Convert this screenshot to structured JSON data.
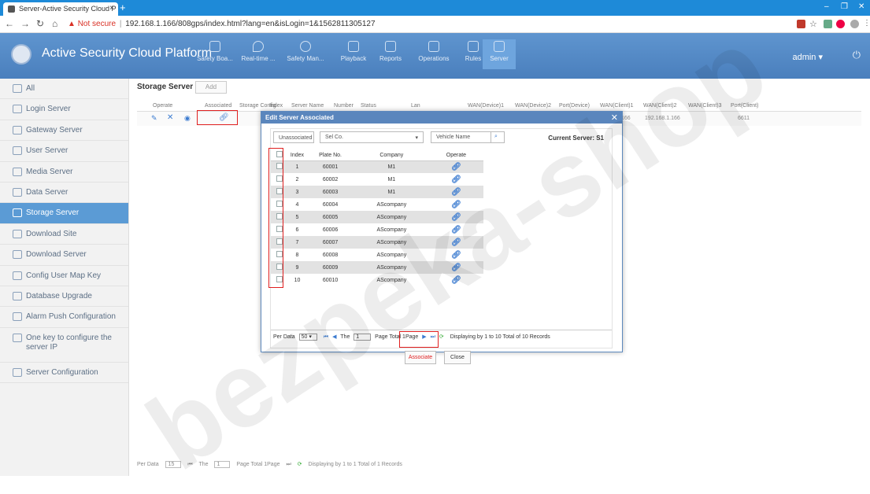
{
  "browser": {
    "tab_title": "Server-Active Security Cloud P",
    "new_tab": "+",
    "not_secure": "Not secure",
    "url": "192.168.1.166/808gps/index.html?lang=en&isLogin=1&1562811305127"
  },
  "app": {
    "title": "Active Security Cloud Platform",
    "nav": [
      "Safety Boa...",
      "Real-time ...",
      "Safety Man...",
      "Playback",
      "Reports",
      "Operations",
      "Rules",
      "Server"
    ],
    "active_nav": "Server",
    "user": "admin ▾"
  },
  "sidebar": {
    "items": [
      {
        "label": "All"
      },
      {
        "label": "Login Server"
      },
      {
        "label": "Gateway Server"
      },
      {
        "label": "User Server"
      },
      {
        "label": "Media Server"
      },
      {
        "label": "Data Server"
      },
      {
        "label": "Storage Server",
        "active": true
      },
      {
        "label": "Download Site"
      },
      {
        "label": "Download Server"
      },
      {
        "label": "Config User Map Key"
      },
      {
        "label": "Database Upgrade"
      },
      {
        "label": "Alarm Push Configuration"
      },
      {
        "label": "One key to configure the server IP"
      },
      {
        "label": "Server Configuration"
      }
    ]
  },
  "main": {
    "title": "Storage Server",
    "add_label": "Add",
    "columns": [
      "Operate",
      "Associated",
      "Storage Config",
      "Index",
      "Server Name",
      "Number",
      "Status",
      "Lan",
      "WAN(Device)1",
      "WAN(Device)2",
      "Port(Device)",
      "WAN(Client)1",
      "WAN(Client)2",
      "WAN(Client)3",
      "Port(Client)"
    ],
    "row": {
      "wan_client_1": "192.168.1.166",
      "port_client": "6611",
      "partial": "166"
    },
    "pager": {
      "per_data": "Per Data",
      "per_value": "15",
      "the": "The",
      "page_value": "1",
      "page_total": "Page  Total 1Page",
      "info": "Displaying by 1 to 1 Total of 1 Records"
    }
  },
  "modal": {
    "title": "Edit Server Associated",
    "filter": {
      "status": "Unassociated",
      "company": "Sel Co.",
      "vehicle_placeholder": "Vehicle Name"
    },
    "current_server": "Current Server: S1",
    "columns": [
      "Index",
      "Plate No.",
      "Company",
      "Operate"
    ],
    "rows": [
      {
        "index": "1",
        "plate": "60001",
        "company": "M1"
      },
      {
        "index": "2",
        "plate": "60002",
        "company": "M1"
      },
      {
        "index": "3",
        "plate": "60003",
        "company": "M1"
      },
      {
        "index": "4",
        "plate": "60004",
        "company": "AScompany"
      },
      {
        "index": "5",
        "plate": "60005",
        "company": "AScompany"
      },
      {
        "index": "6",
        "plate": "60006",
        "company": "AScompany"
      },
      {
        "index": "7",
        "plate": "60007",
        "company": "AScompany"
      },
      {
        "index": "8",
        "plate": "60008",
        "company": "AScompany"
      },
      {
        "index": "9",
        "plate": "60009",
        "company": "AScompany"
      },
      {
        "index": "10",
        "plate": "60010",
        "company": "AScompany"
      }
    ],
    "pager": {
      "per_data": "Per Data",
      "per_value": "50",
      "the": "The",
      "page_value": "1",
      "page_total": "Page  Total 1Page",
      "info": "Displaying by 1 to 10 Total of 10 Records"
    },
    "associate": "Associate",
    "close": "Close"
  },
  "watermark": "bezpeka-shop",
  "colors": {
    "header": "#5b8fcb",
    "active": "#5b9bd5",
    "highlight": "#e02020"
  }
}
